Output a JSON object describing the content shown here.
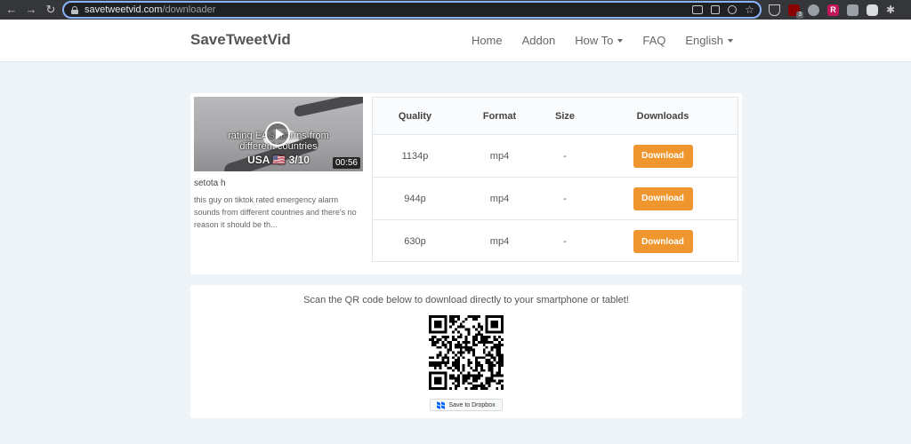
{
  "browser": {
    "url_host": "savetweetvid.com",
    "url_path": "/downloader",
    "ublock_badge": "3",
    "r_extension_letter": "R"
  },
  "site": {
    "brand": "SaveTweetVid",
    "nav": [
      {
        "label": "Home",
        "dropdown": false
      },
      {
        "label": "Addon",
        "dropdown": false
      },
      {
        "label": "How To",
        "dropdown": true
      },
      {
        "label": "FAQ",
        "dropdown": false
      },
      {
        "label": "English",
        "dropdown": true
      }
    ]
  },
  "video": {
    "thumbnail_caption_line1": "rating EAS alarms from",
    "thumbnail_caption_line2": "different countries",
    "thumbnail_caption_line3": "USA 🇺🇸 3/10",
    "duration": "00:56",
    "author": "setota h",
    "description": "this guy on tiktok rated emergency alarm sounds from different countries and there's no reason it should be th..."
  },
  "table": {
    "headers": {
      "quality": "Quality",
      "format": "Format",
      "size": "Size",
      "downloads": "Downloads"
    },
    "rows": [
      {
        "quality": "1134p",
        "format": "mp4",
        "size": "-",
        "button": "Download"
      },
      {
        "quality": "944p",
        "format": "mp4",
        "size": "-",
        "button": "Download"
      },
      {
        "quality": "630p",
        "format": "mp4",
        "size": "-",
        "button": "Download"
      }
    ]
  },
  "qr_section": {
    "instruction": "Scan the QR code below to download directly to your smartphone or tablet!",
    "dropbox_label": "Save to Dropbox"
  },
  "colors": {
    "accent": "#f0962e",
    "background": "#eef3f7",
    "chrome": "#35363a",
    "dropbox": "#0061ff"
  }
}
